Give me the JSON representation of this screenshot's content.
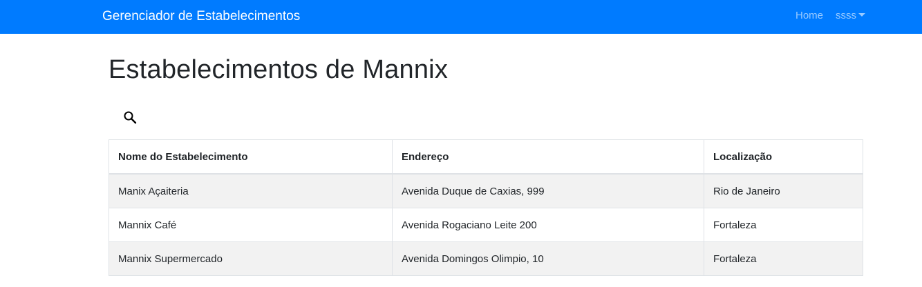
{
  "navbar": {
    "brand": "Gerenciador de Estabelecimentos",
    "home_label": "Home",
    "user_label": "ssss",
    "background": "#007bff"
  },
  "page": {
    "title": "Estabelecimentos de Mannix",
    "search_icon": "search-icon"
  },
  "table": {
    "headers": [
      "Nome do Estabelecimento",
      "Endereço",
      "Localização"
    ],
    "rows": [
      [
        "Manix Açaiteria",
        "Avenida Duque de Caxias, 999",
        "Rio de Janeiro"
      ],
      [
        "Mannix Café",
        "Avenida Rogaciano Leite 200",
        "Fortaleza"
      ],
      [
        "Mannix Supermercado",
        "Avenida Domingos Olimpio, 10",
        "Fortaleza"
      ]
    ],
    "striped_color": "#f2f2f2"
  }
}
